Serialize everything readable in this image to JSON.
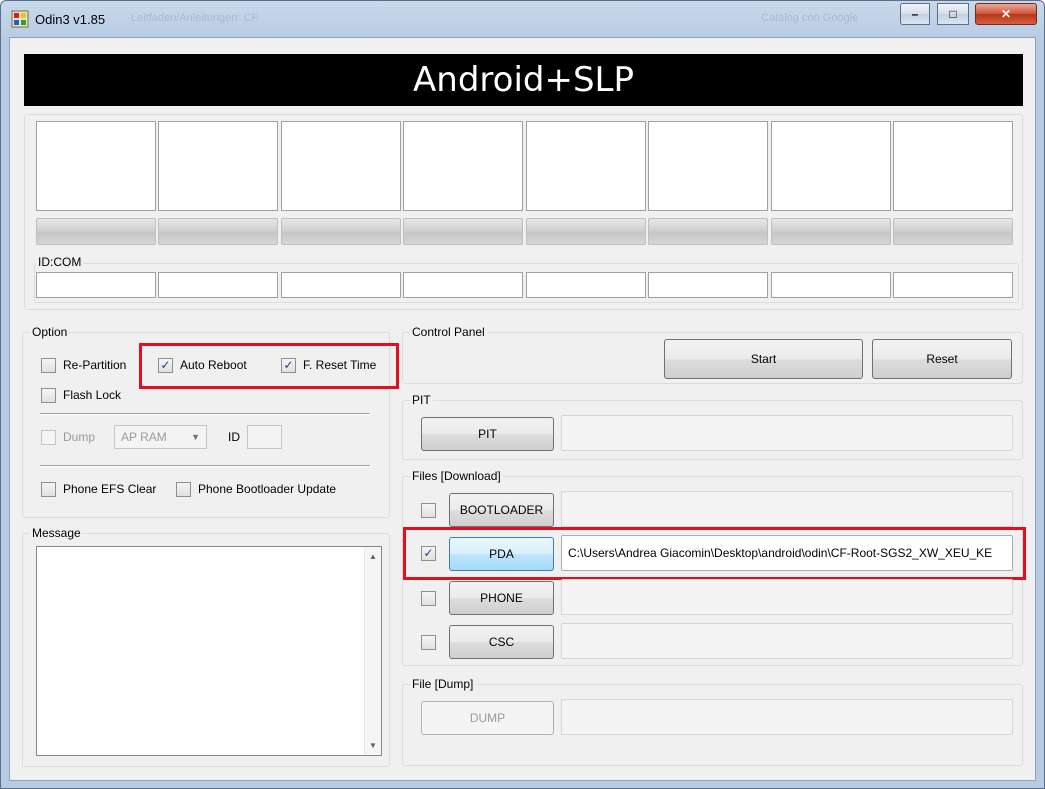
{
  "window": {
    "title": "Odin3 v1.85",
    "ghost_text_1": "Leitfaden/Anleitungen: CF",
    "ghost_text_2": "Catalog con Google",
    "minimize": "–",
    "maximize": "□",
    "close": "✕"
  },
  "banner": {
    "title": "Android+SLP"
  },
  "ports": {
    "id_com_label": "ID:COM"
  },
  "option": {
    "label": "Option",
    "re_partition": {
      "label": "Re-Partition",
      "checked": false
    },
    "auto_reboot": {
      "label": "Auto Reboot",
      "checked": true
    },
    "f_reset_time": {
      "label": "F. Reset Time",
      "checked": true
    },
    "flash_lock": {
      "label": "Flash Lock",
      "checked": false
    },
    "dump": {
      "label": "Dump",
      "checked": false
    },
    "dump_select": "AP RAM",
    "id_label": "ID",
    "phone_efs_clear": {
      "label": "Phone EFS Clear",
      "checked": false
    },
    "phone_bootloader_update": {
      "label": "Phone Bootloader Update",
      "checked": false
    }
  },
  "message": {
    "label": "Message"
  },
  "control_panel": {
    "label": "Control Panel",
    "start": "Start",
    "reset": "Reset"
  },
  "pit": {
    "label": "PIT",
    "button": "PIT",
    "path": ""
  },
  "files": {
    "label": "Files [Download]",
    "bootloader": {
      "button": "BOOTLOADER",
      "checked": false,
      "path": ""
    },
    "pda": {
      "button": "PDA",
      "checked": true,
      "path": "C:\\Users\\Andrea Giacomin\\Desktop\\android\\odin\\CF-Root-SGS2_XW_XEU_KE"
    },
    "phone": {
      "button": "PHONE",
      "checked": false,
      "path": ""
    },
    "csc": {
      "button": "CSC",
      "checked": false,
      "path": ""
    }
  },
  "file_dump": {
    "label": "File [Dump]",
    "button": "DUMP",
    "path": ""
  },
  "colors": {
    "highlight": "#e01020",
    "banner_bg": "#000000",
    "banner_fg": "#ffffff"
  }
}
